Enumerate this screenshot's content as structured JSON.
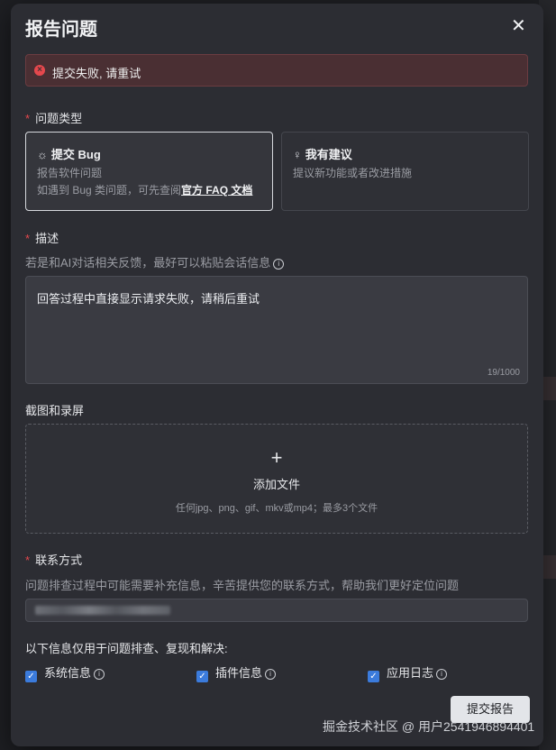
{
  "dialog": {
    "title": "报告问题",
    "close_icon": "✕"
  },
  "alert": {
    "icon": "close-circle",
    "message": "提交失败, 请重试",
    "color": "#e5484d"
  },
  "issue_type": {
    "label": "问题类型",
    "required_mark": "*",
    "options": [
      {
        "icon": "bug",
        "title": "提交 Bug",
        "sub1": "报告软件问题",
        "sub2_prefix": "如遇到 Bug 类问题，可先查阅",
        "sub2_link": "官方 FAQ 文档",
        "selected": true
      },
      {
        "icon": "lightbulb",
        "title": "我有建议",
        "sub1": "提议新功能或者改进措施",
        "selected": false
      }
    ]
  },
  "description": {
    "label": "描述",
    "required_mark": "*",
    "hint": "若是和AI对话相关反馈，最好可以粘贴会话信息",
    "value": "回答过程中直接显示请求失败，请稍后重试",
    "counter": "19/1000"
  },
  "screenshots": {
    "label": "截图和录屏",
    "plus": "+",
    "title": "添加文件",
    "hint": "任何jpg、png、gif、mkv或mp4；最多3个文件"
  },
  "contact": {
    "label": "联系方式",
    "required_mark": "*",
    "hint": "问题排查过程中可能需要补充信息，辛苦提供您的联系方式，帮助我们更好定位问题"
  },
  "consent": {
    "text": "以下信息仅用于问题排查、复现和解决:",
    "items": [
      {
        "label": "系统信息",
        "checked": true
      },
      {
        "label": "插件信息",
        "checked": true
      },
      {
        "label": "应用日志",
        "checked": true
      }
    ]
  },
  "submit_label": "提交报告",
  "watermark": "掘金技术社区 @ 用户2541946894401",
  "colors": {
    "accent": "#3b7bdc",
    "error": "#e5484d",
    "modal_bg": "#2c2d33"
  }
}
